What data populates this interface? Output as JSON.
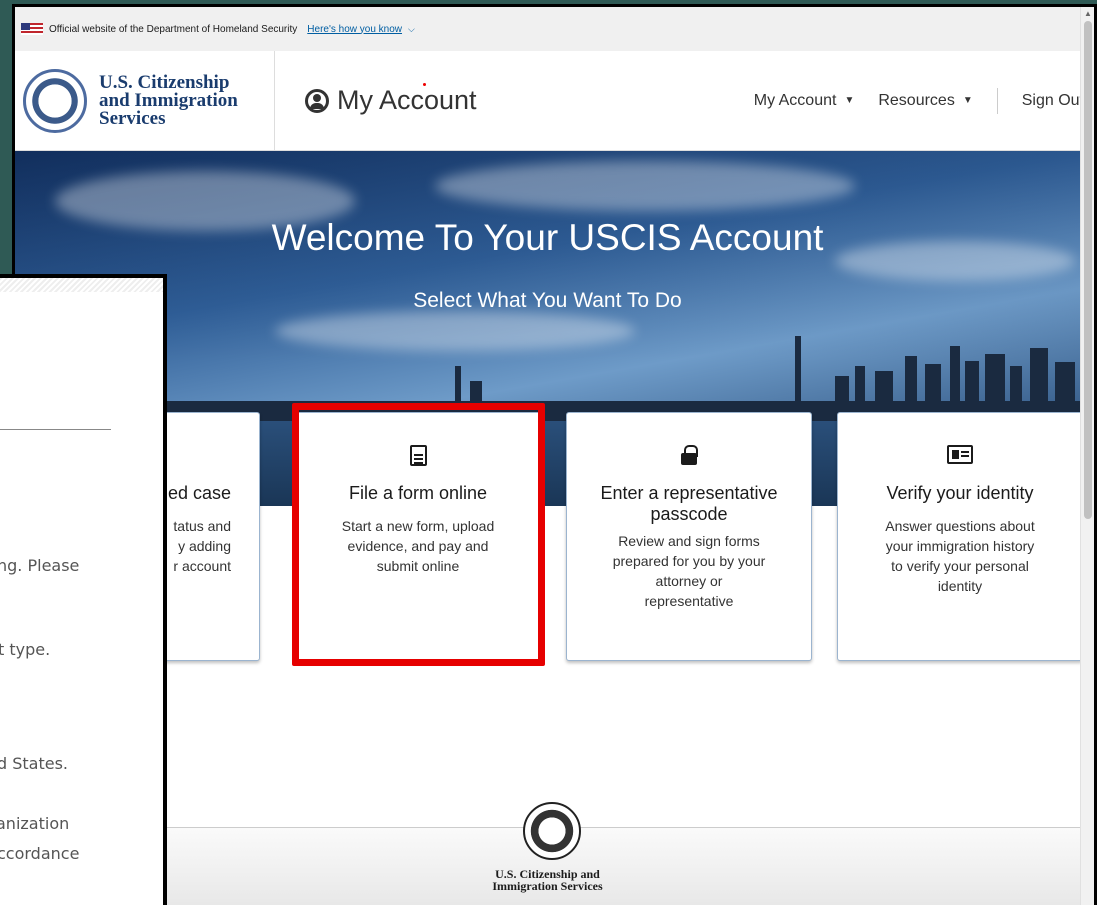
{
  "gov_banner": {
    "text": "Official website of the Department of Homeland Security",
    "link": "Here's how you know"
  },
  "header": {
    "agency_name": "U.S. Citizenship and Immigration Services",
    "agency_lines": [
      "U.S. Citizenship",
      "and Immigration",
      "Services"
    ],
    "title": "My Account",
    "nav": {
      "my_account": "My Account",
      "resources": "Resources",
      "sign_out": "Sign Out"
    }
  },
  "hero": {
    "title": "Welcome To Your USCIS Account",
    "subtitle": "Select What You Want To Do"
  },
  "cards": [
    {
      "title": "led case",
      "desc_lines": [
        "tatus and",
        "y adding",
        "r account"
      ]
    },
    {
      "title": "File a form online",
      "icon": "document-icon",
      "desc_lines": [
        "Start a new form, upload",
        "evidence, and pay and",
        "submit online"
      ]
    },
    {
      "title_lines": [
        "Enter a representative",
        "passcode"
      ],
      "icon": "lock-icon",
      "desc_lines": [
        "Review and sign forms",
        "prepared for you by your",
        "attorney or",
        "representative"
      ]
    },
    {
      "title": "Verify your identity",
      "icon": "id-card-icon",
      "desc_lines": [
        "Answer questions about",
        "your immigration history",
        "to verify your personal",
        "identity"
      ]
    }
  ],
  "footer": {
    "lines": [
      "U.S. Citizenship and",
      "Immigration Services"
    ]
  },
  "overlay": {
    "lines": [
      "ng. Please",
      "t type.",
      "d States.",
      "anization",
      "ccordance"
    ]
  },
  "colors": {
    "highlight": "#e60000",
    "brand_navy": "#1a3c6e",
    "desktop_bg": "#2f5a55"
  }
}
